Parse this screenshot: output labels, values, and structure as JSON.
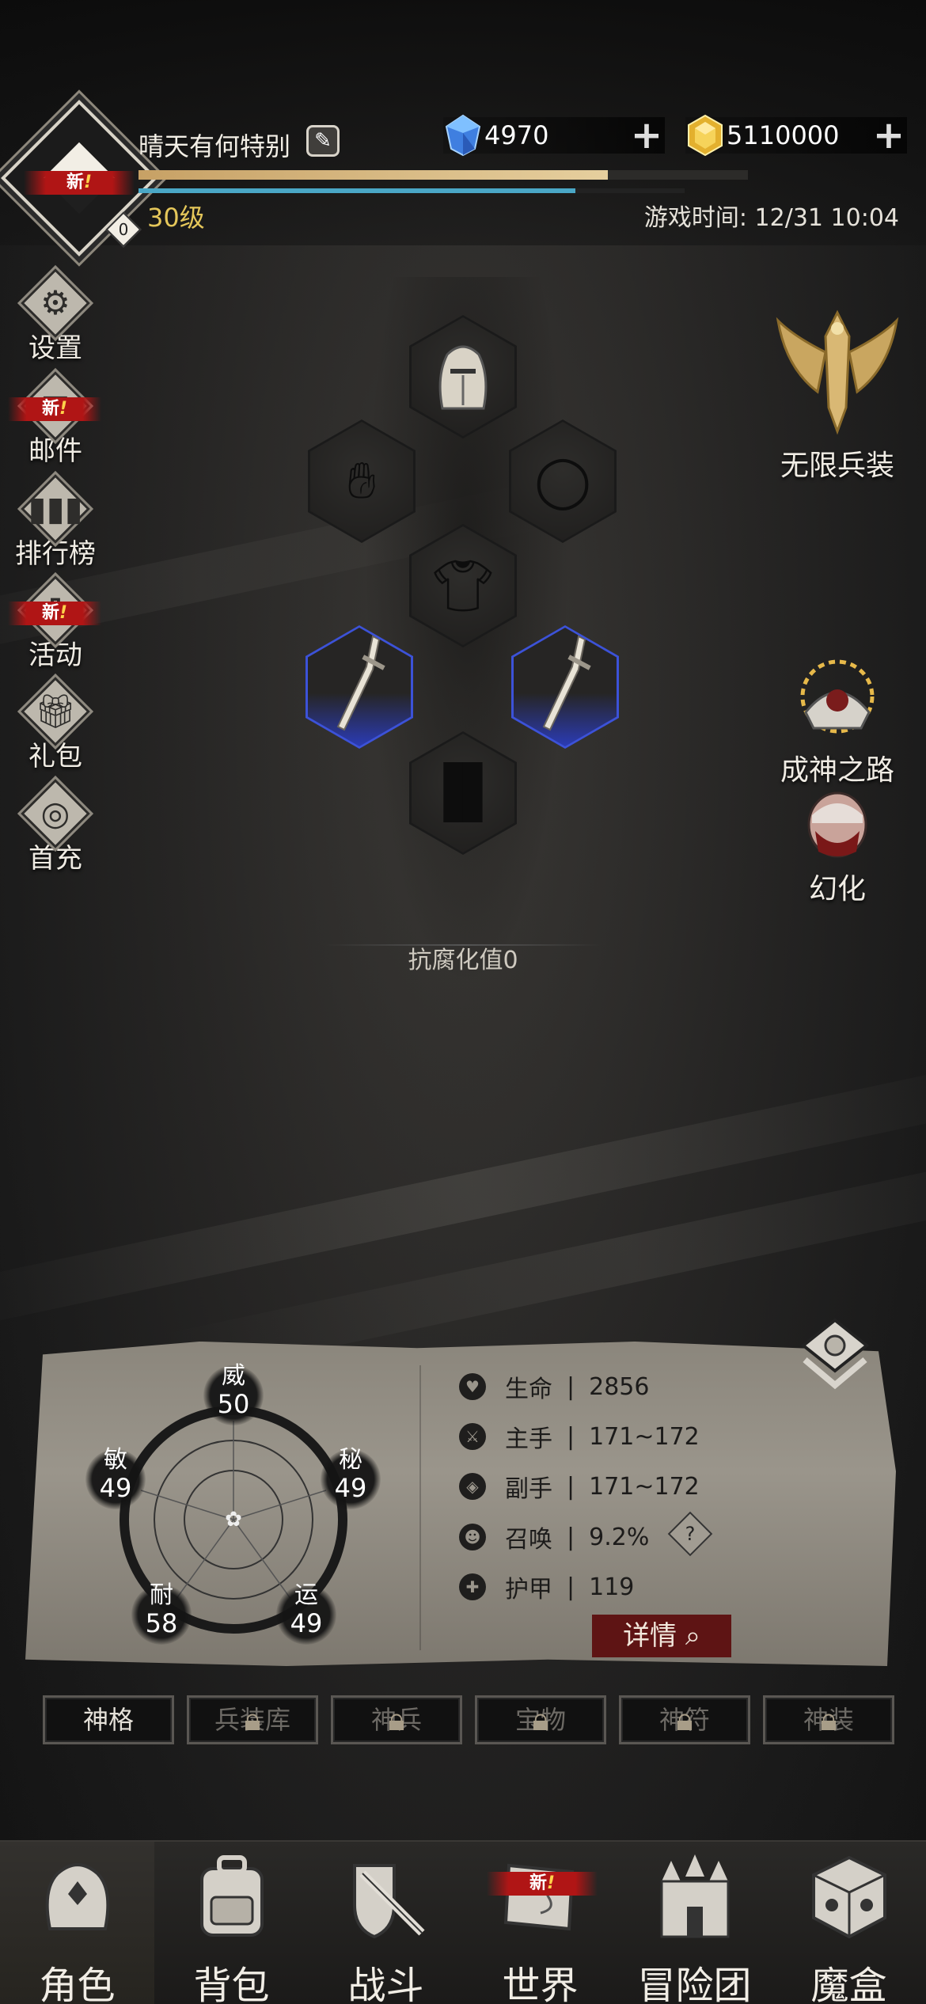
{
  "header": {
    "player_name": "晴天有何特别",
    "new_badge": "新",
    "avatar_badge_count": "0",
    "level_label": "30级",
    "xp_progress": 0.77,
    "mp_progress": 0.8,
    "game_time": "游戏时间: 12/31 10:04",
    "diamonds": "4970",
    "gold": "5110000"
  },
  "left_menu": [
    {
      "label": "设置",
      "icon": "gear-icon",
      "new": false
    },
    {
      "label": "邮件",
      "icon": "mail-icon",
      "new": true
    },
    {
      "label": "排行榜",
      "icon": "ranking-icon",
      "new": false
    },
    {
      "label": "活动",
      "icon": "event-icon",
      "new": true
    },
    {
      "label": "礼包",
      "icon": "gift-icon",
      "new": false
    },
    {
      "label": "首充",
      "icon": "first-recharge-icon",
      "new": false
    }
  ],
  "right_menu": {
    "infinite_gear": "无限兵装",
    "god_path": "成神之路",
    "transform": "幻化"
  },
  "equipment": {
    "corruption_resistance": "抗腐化值0"
  },
  "attributes": {
    "wei": {
      "name": "威",
      "value": "50"
    },
    "mi": {
      "name": "秘",
      "value": "49"
    },
    "yun": {
      "name": "运",
      "value": "49"
    },
    "nai": {
      "name": "耐",
      "value": "58"
    },
    "min": {
      "name": "敏",
      "value": "49"
    }
  },
  "stats": [
    {
      "label": "生命",
      "value": "2856"
    },
    {
      "label": "主手",
      "value": "171~172"
    },
    {
      "label": "副手",
      "value": "171~172"
    },
    {
      "label": "召唤",
      "value": "9.2%"
    },
    {
      "label": "护甲",
      "value": "119"
    }
  ],
  "stat_separator": "|",
  "detail_button": "详情",
  "tabs": [
    {
      "label": "神格",
      "locked": false
    },
    {
      "label": "兵装库",
      "locked": true
    },
    {
      "label": "神兵",
      "locked": true
    },
    {
      "label": "宝物",
      "locked": true
    },
    {
      "label": "神符",
      "locked": true
    },
    {
      "label": "神装",
      "locked": true
    }
  ],
  "bottom_nav": [
    {
      "label": "角色",
      "active": true,
      "new": false
    },
    {
      "label": "背包",
      "active": false,
      "new": false
    },
    {
      "label": "战斗",
      "active": false,
      "new": false
    },
    {
      "label": "世界",
      "active": false,
      "new": true
    },
    {
      "label": "冒险团",
      "active": false,
      "new": false
    },
    {
      "label": "魔盒",
      "active": false,
      "new": false
    }
  ],
  "colors": {
    "accent_gold": "#e5c75a",
    "xp_bar": "#d9bb83",
    "mp_bar": "#4aa7c6",
    "rare_blue": "#3c52d8",
    "new_red": "#b01515",
    "detail_red": "#5e1414"
  }
}
